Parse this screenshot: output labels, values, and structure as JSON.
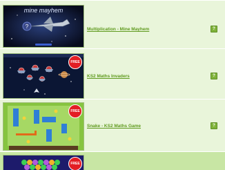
{
  "games": [
    {
      "title": "Multiplication - Mine Mayhem",
      "thumb_caption": "mine mayhem",
      "help_label": "?",
      "free_badge": ""
    },
    {
      "title": "KS2 Maths Invaders",
      "help_label": "?",
      "free_badge": "FREE"
    },
    {
      "title": "Snake - KS2 Maths Game",
      "help_label": "?",
      "free_badge": "FREE"
    },
    {
      "title": "",
      "help_label": "",
      "free_badge": "FREE"
    }
  ],
  "colors": {
    "row_bg": "#e9f5da",
    "row_active_bg": "#c8e6a4",
    "link": "#5f9a1e",
    "help_button": "#7fb23a",
    "free_badge": "#e31e24"
  }
}
